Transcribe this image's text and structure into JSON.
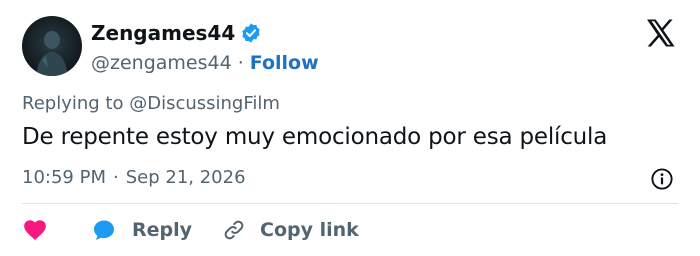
{
  "author": {
    "display_name": "Zengames44",
    "handle": "@zengames44",
    "separator": "·",
    "follow_label": "Follow",
    "verified": true
  },
  "reply_context": {
    "prefix": "Replying to ",
    "mention": "@DiscussingFilm"
  },
  "tweet": {
    "text": "De repente estoy muy emocionado por esa película",
    "time": "10:59 PM",
    "separator": "·",
    "date": "Sep 21, 2026"
  },
  "actions": {
    "like_icon": "heart-icon",
    "reply_label": "Reply",
    "reply_icon": "speech-bubble-icon",
    "copy_link_label": "Copy link",
    "copy_link_icon": "link-icon"
  },
  "colors": {
    "accent_blue": "#1d72c4",
    "verified_blue": "#1d9bf0",
    "heart_pink": "#f91880",
    "text_primary": "#0f1419",
    "text_secondary": "#536471"
  }
}
